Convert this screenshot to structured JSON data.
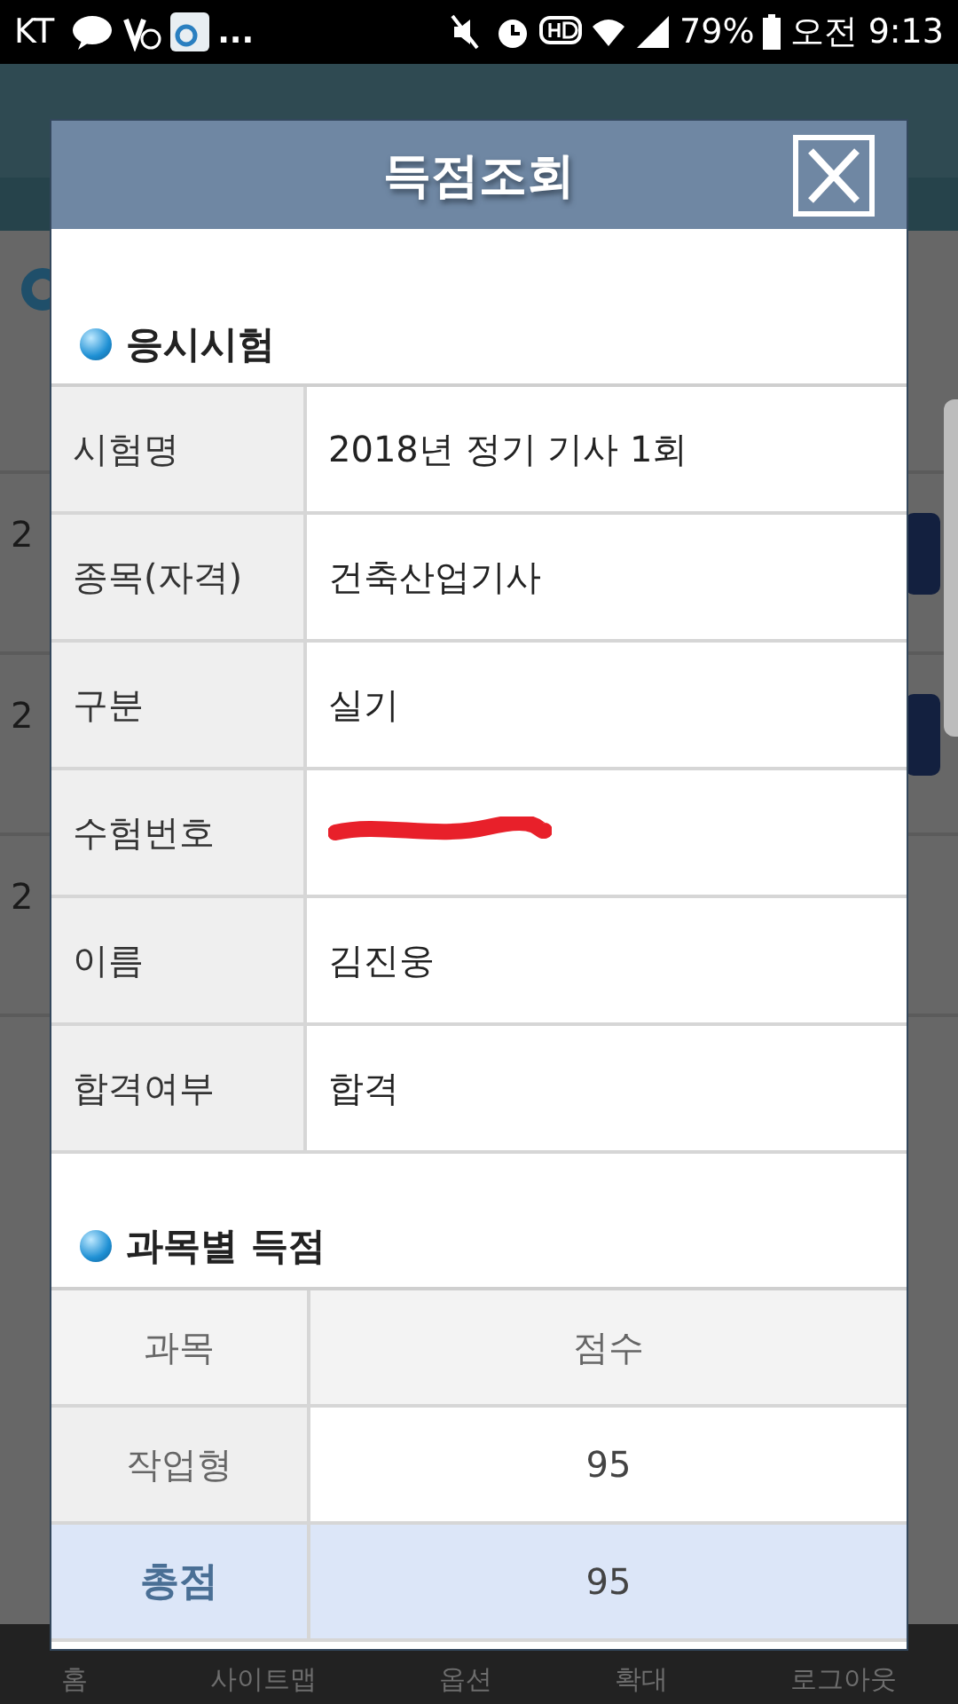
{
  "status_bar": {
    "carrier": "KT",
    "more": "...",
    "battery": "79%",
    "time": "오전 9:13"
  },
  "background_page": {
    "rows": [
      {
        "cell": "2",
        "has_button": true
      },
      {
        "cell": "2",
        "has_button": true
      },
      {
        "cell": "2",
        "has_button": false
      }
    ]
  },
  "dialog": {
    "title": "득점조회",
    "exam_section": {
      "title": "응시시험",
      "rows": [
        {
          "kind": "text",
          "label": "시험명",
          "value": "2018년 정기 기사 1회"
        },
        {
          "kind": "text",
          "label": "종목(자격)",
          "value": "건축산업기사"
        },
        {
          "kind": "text",
          "label": "구분",
          "value": "실기"
        },
        {
          "kind": "redacted",
          "label": "수험번호"
        },
        {
          "kind": "text",
          "label": "이름",
          "value": "김진웅"
        },
        {
          "kind": "text",
          "label": "합격여부",
          "value": "합격"
        }
      ]
    },
    "score_section": {
      "title": "과목별 득점",
      "columns": [
        "과목",
        "점수"
      ],
      "rows": [
        {
          "kind": "subject",
          "subject": "작업형",
          "score": "95"
        },
        {
          "kind": "total",
          "subject": "총점",
          "score": "95"
        }
      ]
    }
  },
  "bottom_nav": [
    {
      "label": "홈"
    },
    {
      "label": "사이트맵"
    },
    {
      "label": "옵션"
    },
    {
      "label": "확대"
    },
    {
      "label": "로그아웃"
    }
  ]
}
